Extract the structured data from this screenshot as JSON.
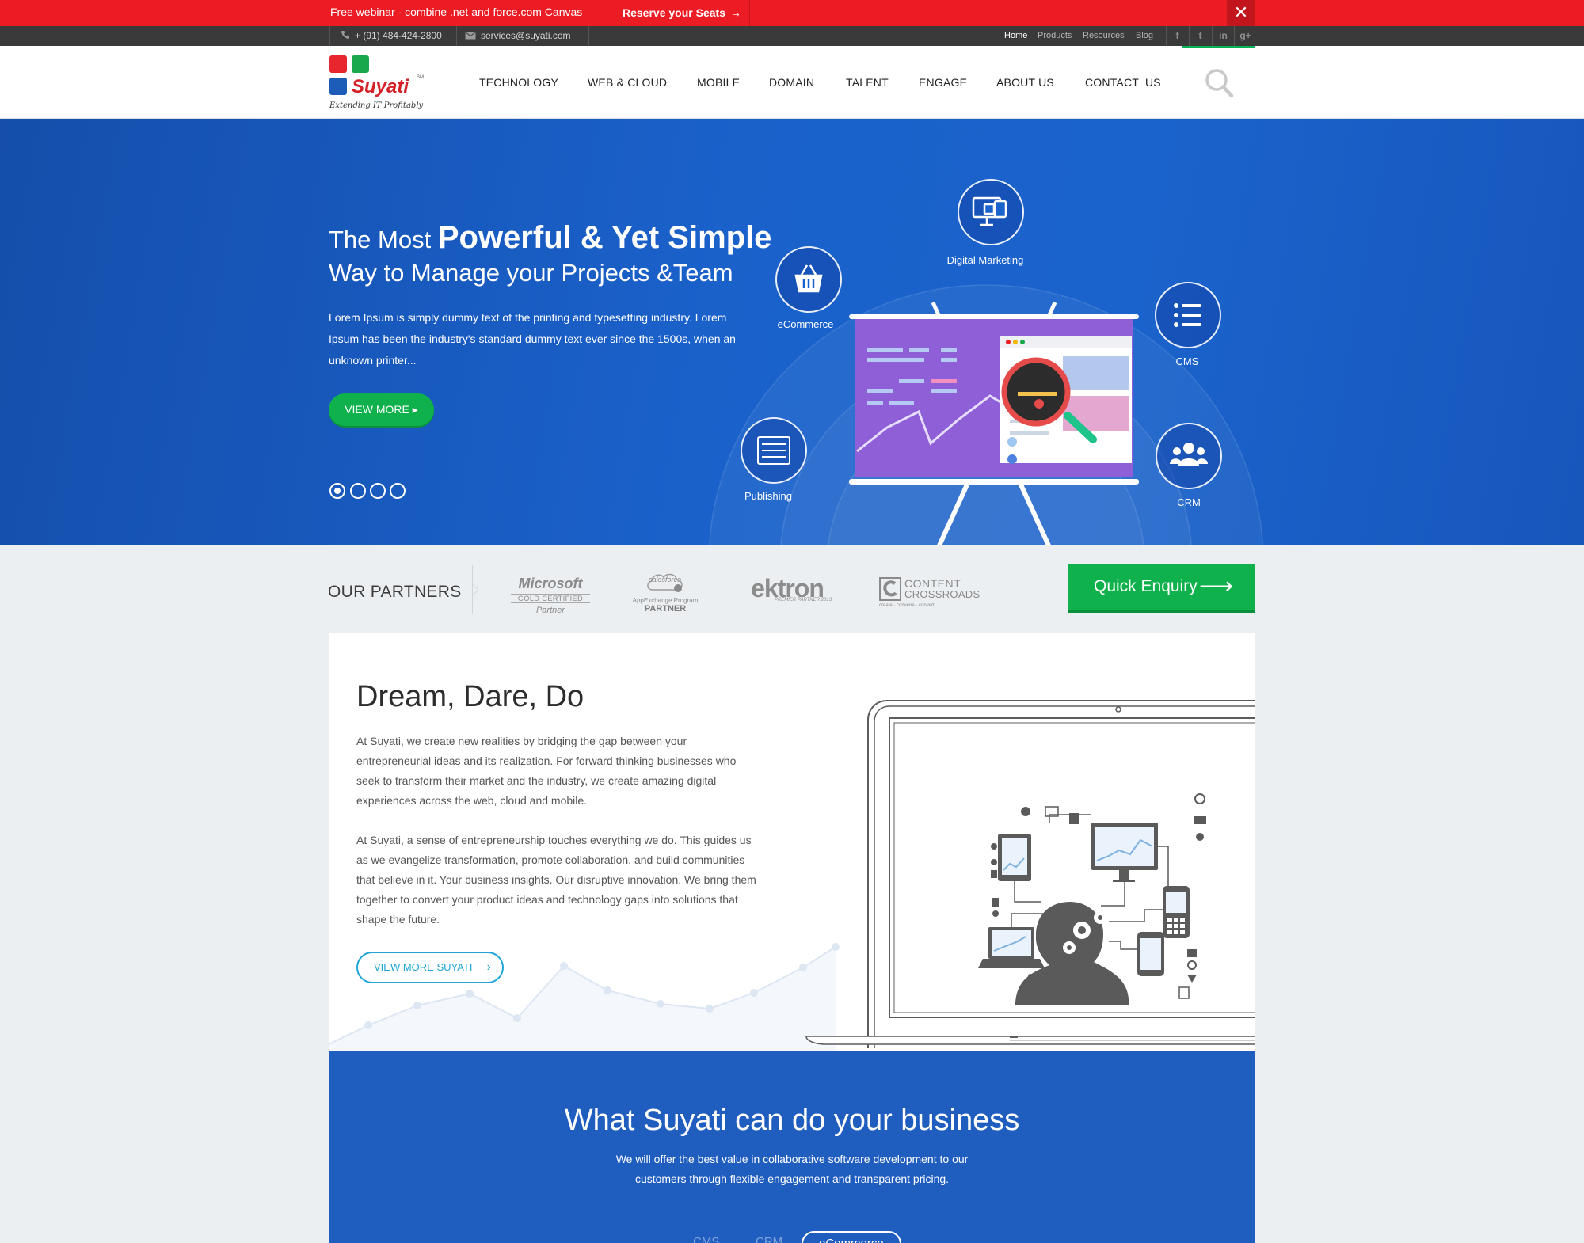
{
  "promo": {
    "text": "Free webinar - combine .net and force.com Canvas",
    "cta": "Reserve your Seats",
    "cta_arrow": "→",
    "close": "✕"
  },
  "utility": {
    "phone": "+ (91) 484-424-2800",
    "email": "services@suyati.com",
    "links": [
      "Home",
      "Products",
      "Resources",
      "Blog"
    ],
    "social": [
      "f",
      "t",
      "in",
      "g+"
    ]
  },
  "logo": {
    "name": "Suyati",
    "sm": "SM",
    "tagline": "Extending IT Profitably",
    "colors": [
      "#e8262d",
      "#19a84a",
      "#1d5db8",
      "#1d5db8"
    ]
  },
  "nav": [
    "TECHNOLOGY",
    "WEB & CLOUD",
    "MOBILE",
    "DOMAIN",
    "TALENT",
    "ENGAGE",
    "ABOUT US",
    "CONTACT  US"
  ],
  "hero": {
    "title_pre": "The Most ",
    "title_bold": "Powerful & Yet Simple",
    "title_line2": "Way to Manage your Projects &Team",
    "paragraph": "Lorem Ipsum is simply dummy text of the printing and typesetting industry. Lorem Ipsum has been the industry's standard dummy text ever since the 1500s, when an unknown printer...",
    "button": "VIEW MORE",
    "button_arrow": "▸",
    "services": [
      "Digital Marketing",
      "eCommerce",
      "CMS",
      "Publishing",
      "CRM"
    ],
    "slides": 4,
    "active_slide": 1
  },
  "partners": {
    "label": "OUR PARTNERS",
    "logos": [
      {
        "line1": "Microsoft",
        "line2": "GOLD CERTIFIED",
        "line3": "Partner"
      },
      {
        "line1": "salesforce",
        "line2": "AppExchange Program",
        "line3": "PARTNER"
      },
      {
        "line1": "ektron",
        "line2": "PREMIER PARTNER 2013"
      },
      {
        "line1": "CONTENT",
        "line2": "CROSSROADS",
        "line3": "create · convene · convert"
      }
    ],
    "quick_enquiry": "Quick Enquiry",
    "qe_arrow": "⟶"
  },
  "dream": {
    "title": "Dream, Dare, Do",
    "p1": "At Suyati, we create new realities by bridging the gap between your entrepreneurial ideas and its realization. For forward thinking businesses who seek to transform their market and the industry, we create amazing digital experiences across the web, cloud and mobile.",
    "p2": "At Suyati, a sense of entrepreneurship touches everything we do. This guides us as we evangelize transformation, promote collaboration, and build communities that believe in it. Your business insights. Our disruptive innovation. We bring them together to convert your product ideas and technology gaps into solutions that shape the future.",
    "button": "VIEW MORE SUYATI",
    "chevron": "›"
  },
  "what": {
    "title": "What Suyati can do your business",
    "paragraph": "We will offer the best value in collaborative software development to our customers through flexible engagement and transparent pricing.",
    "tabs": [
      "CMS",
      "CRM",
      "eCommerce"
    ],
    "active_tab": "eCommerce"
  }
}
